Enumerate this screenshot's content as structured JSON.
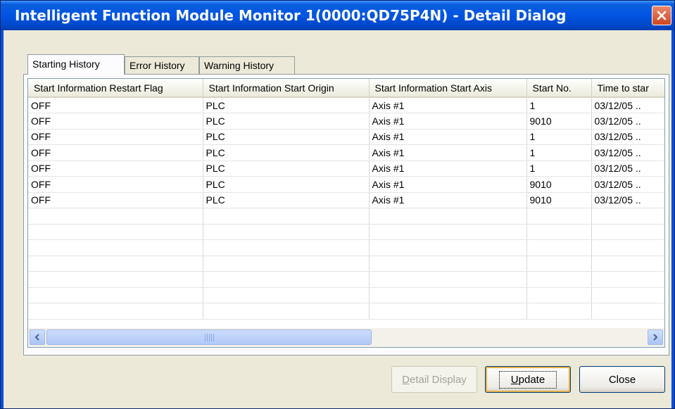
{
  "window": {
    "title": "Intelligent Function Module Monitor 1(0000:QD75P4N) - Detail Dialog",
    "close_glyph": "✕"
  },
  "tabs": [
    {
      "label": "Starting History",
      "active": true
    },
    {
      "label": "Error History",
      "active": false
    },
    {
      "label": "Warning History",
      "active": false
    }
  ],
  "list": {
    "columns": [
      "Start Information Restart Flag",
      "Start Information Start Origin",
      "Start Information Start Axis",
      "Start No.",
      "Time to star"
    ],
    "rows": [
      [
        "OFF",
        "PLC",
        "Axis #1",
        "1",
        "03/12/05 .."
      ],
      [
        "OFF",
        "PLC",
        "Axis #1",
        "9010",
        "03/12/05 .."
      ],
      [
        "OFF",
        "PLC",
        "Axis #1",
        "1",
        "03/12/05 .."
      ],
      [
        "OFF",
        "PLC",
        "Axis #1",
        "1",
        "03/12/05 .."
      ],
      [
        "OFF",
        "PLC",
        "Axis #1",
        "1",
        "03/12/05 .."
      ],
      [
        "OFF",
        "PLC",
        "Axis #1",
        "9010",
        "03/12/05 .."
      ],
      [
        "OFF",
        "PLC",
        "Axis #1",
        "9010",
        "03/12/05 .."
      ],
      [
        "",
        "",
        "",
        "",
        ""
      ],
      [
        "",
        "",
        "",
        "",
        ""
      ],
      [
        "",
        "",
        "",
        "",
        ""
      ],
      [
        "",
        "",
        "",
        "",
        ""
      ],
      [
        "",
        "",
        "",
        "",
        ""
      ],
      [
        "",
        "",
        "",
        "",
        ""
      ],
      [
        "",
        "",
        "",
        "",
        ""
      ]
    ]
  },
  "buttons": {
    "detail_display": {
      "label": "Detail Display",
      "mnemonic": "D",
      "rest": "etail Display",
      "enabled": false
    },
    "update": {
      "label": "Update",
      "mnemonic": "U",
      "rest": "pdate"
    },
    "close": {
      "label": "Close"
    }
  },
  "icons": {
    "scroll_left": "scroll-left-arrow-icon",
    "scroll_right": "scroll-right-arrow-icon",
    "close": "close-x-icon"
  },
  "colors": {
    "titlebar": "#0054e3",
    "face": "#ece9d8",
    "close_button": "#d0461f"
  }
}
